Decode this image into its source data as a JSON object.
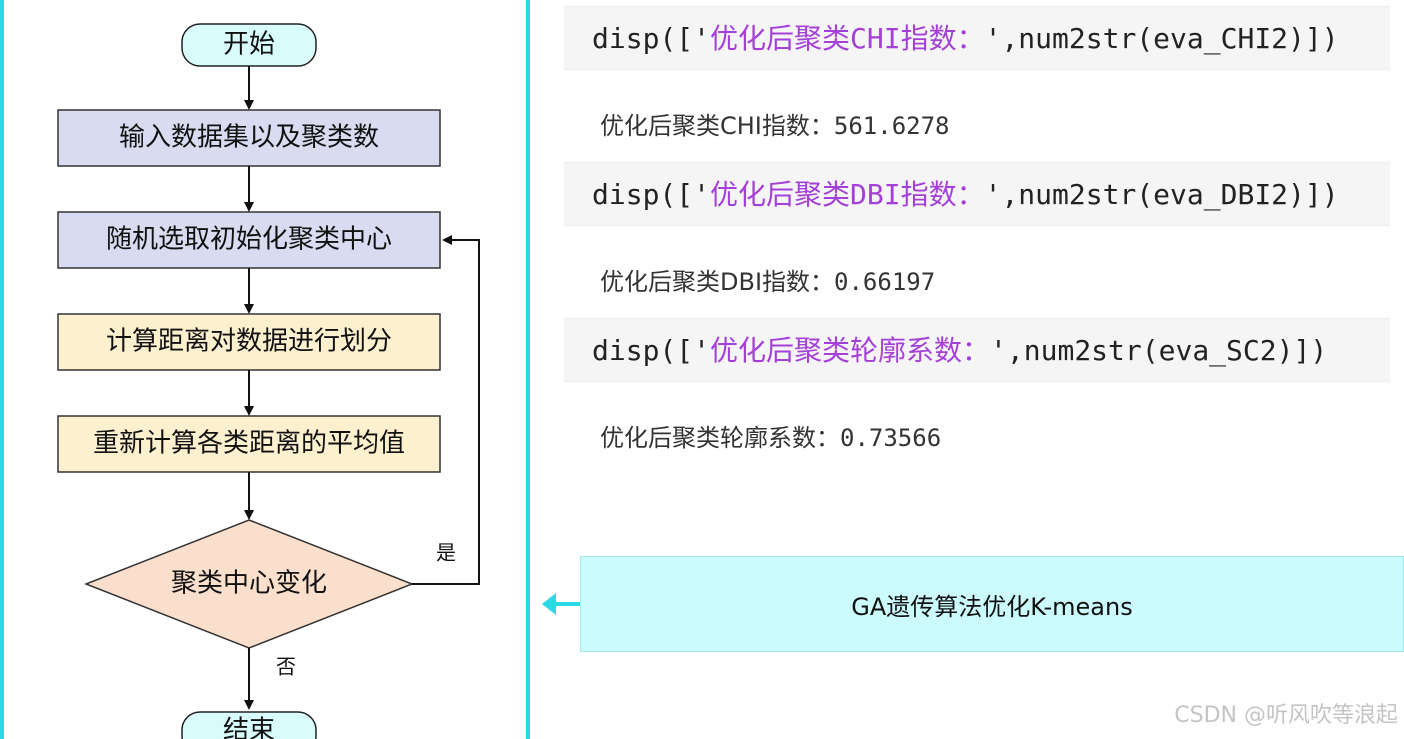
{
  "flowchart": {
    "start": "开始",
    "input": "输入数据集以及聚类数",
    "init_centers": "随机选取初始化聚类中心",
    "assign": "计算距离对数据进行划分",
    "recompute": "重新计算各类距离的平均值",
    "decision": "聚类中心变化",
    "yes_label": "是",
    "no_label": "否",
    "end": "结束"
  },
  "code_cells": [
    {
      "prefix": "disp(['",
      "string": "优化后聚类CHI指数：",
      "suffix": "',num2str(eva_CHI2)])",
      "output_label": "优化后聚类CHI指数：",
      "output_value": "561.6278"
    },
    {
      "prefix": "disp(['",
      "string": "优化后聚类DBI指数：",
      "suffix": "',num2str(eva_DBI2)])",
      "output_label": "优化后聚类DBI指数：",
      "output_value": "0.66197"
    },
    {
      "prefix": "disp(['",
      "string": "优化后聚类轮廓系数：",
      "suffix": "',num2str(eva_SC2)])",
      "output_label": "优化后聚类轮廓系数：",
      "output_value": "0.73566"
    }
  ],
  "banner": {
    "text": "GA遗传算法优化K-means"
  },
  "watermark": "CSDN @听风吹等浪起",
  "colors": {
    "accent_cyan": "#2ad9e6",
    "terminal_fill": "#d8fbfc",
    "blue_box": "#d9dcf0",
    "yellow_box": "#fdf0cf",
    "diamond_fill": "#fbdfcd",
    "code_string": "#a43fd8"
  }
}
